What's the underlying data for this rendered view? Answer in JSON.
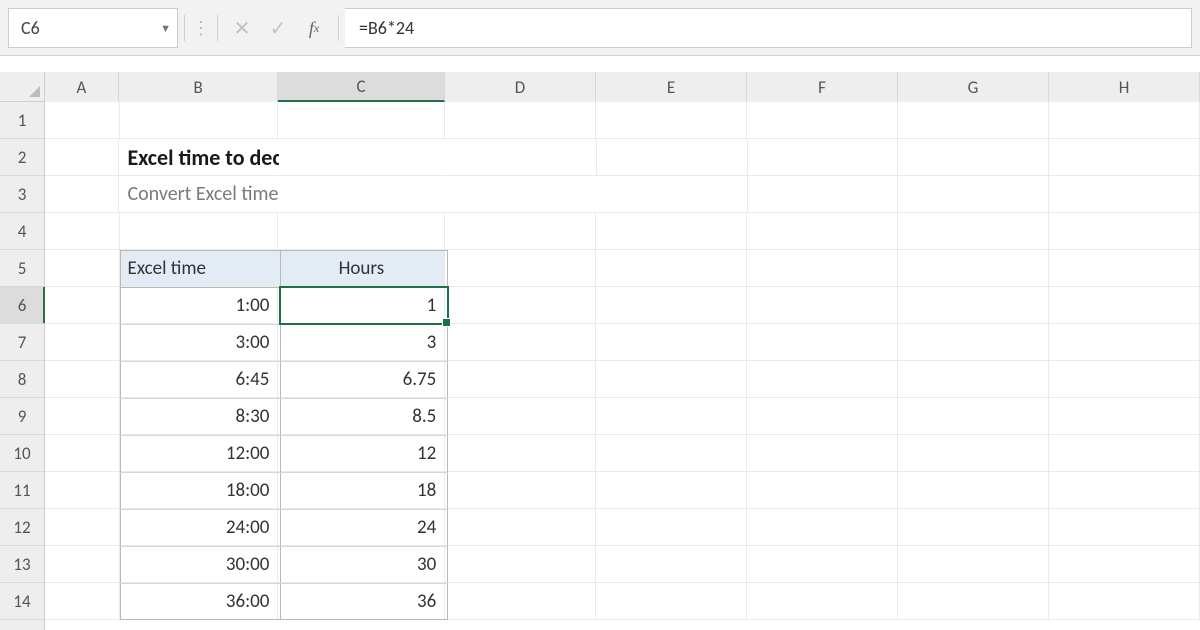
{
  "formula_bar": {
    "cell_ref": "C6",
    "formula": "=B6*24",
    "cancel_icon": "✕",
    "enter_icon": "✓",
    "fx_label": "fx",
    "dropdown_glyph": "▼",
    "dots": "⋮"
  },
  "columns": [
    "A",
    "B",
    "C",
    "D",
    "E",
    "F",
    "G",
    "H"
  ],
  "rows": [
    "1",
    "2",
    "3",
    "4",
    "5",
    "6",
    "7",
    "8",
    "9",
    "10",
    "11",
    "12",
    "13",
    "14"
  ],
  "active_col": "C",
  "active_row": "6",
  "content": {
    "title": "Excel time to decimal hours",
    "subtitle": "Convert Excel time values to decimal hours",
    "header_time": "Excel time",
    "header_hours": "Hours",
    "data": [
      {
        "time": "1:00",
        "hours": "1"
      },
      {
        "time": "3:00",
        "hours": "3"
      },
      {
        "time": "6:45",
        "hours": "6.75"
      },
      {
        "time": "8:30",
        "hours": "8.5"
      },
      {
        "time": "12:00",
        "hours": "12"
      },
      {
        "time": "18:00",
        "hours": "18"
      },
      {
        "time": "24:00",
        "hours": "24"
      },
      {
        "time": "30:00",
        "hours": "30"
      },
      {
        "time": "36:00",
        "hours": "36"
      }
    ]
  }
}
